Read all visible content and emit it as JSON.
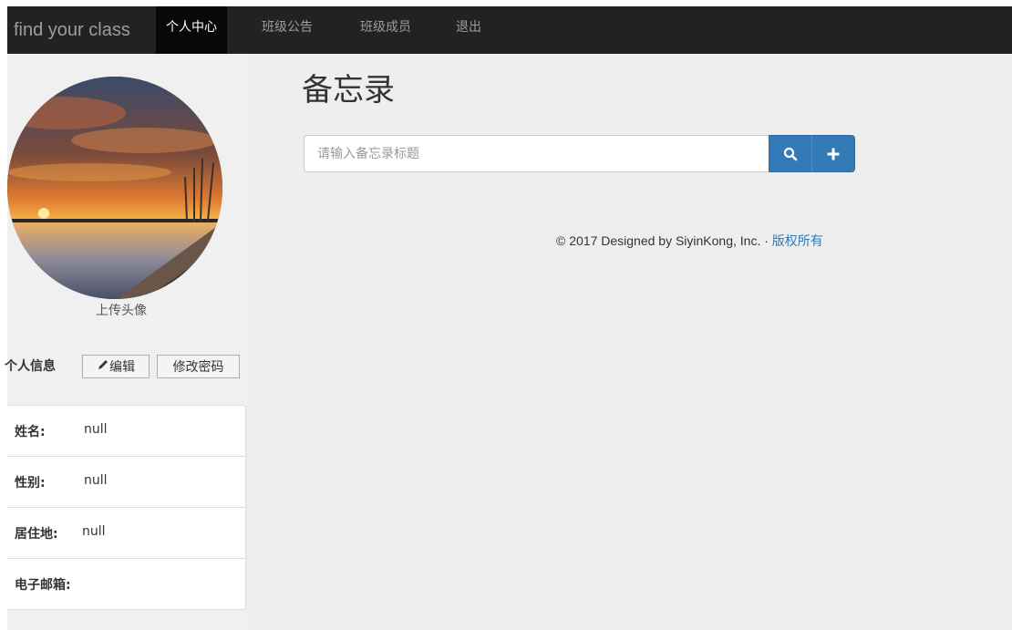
{
  "navbar": {
    "brand": "find your class",
    "items": [
      {
        "label": "个人中心",
        "active": true
      },
      {
        "label": "班级公告",
        "active": false
      },
      {
        "label": "班级成员",
        "active": false
      },
      {
        "label": "退出",
        "active": false
      }
    ]
  },
  "profile": {
    "upload_label": "上传头像",
    "info_title": "个人信息",
    "edit_label": "编辑",
    "change_password_label": "修改密码",
    "fields": [
      {
        "key": "姓名:",
        "value": "null"
      },
      {
        "key": "性别:",
        "value": "null"
      },
      {
        "key": "居住地:",
        "value": "null"
      },
      {
        "key": "电子邮箱:",
        "value": ""
      }
    ]
  },
  "memo": {
    "title": "备忘录",
    "search_placeholder": "请输入备忘录标题"
  },
  "footer": {
    "text": "© 2017 Designed by SiyinKong, Inc. · ",
    "link": "版权所有"
  },
  "colors": {
    "navbar_bg": "#222222",
    "accent": "#337ab7",
    "main_bg": "#eeeeee"
  },
  "icons": {
    "search": "search-icon",
    "add": "plus-icon",
    "edit": "pencil-icon"
  }
}
